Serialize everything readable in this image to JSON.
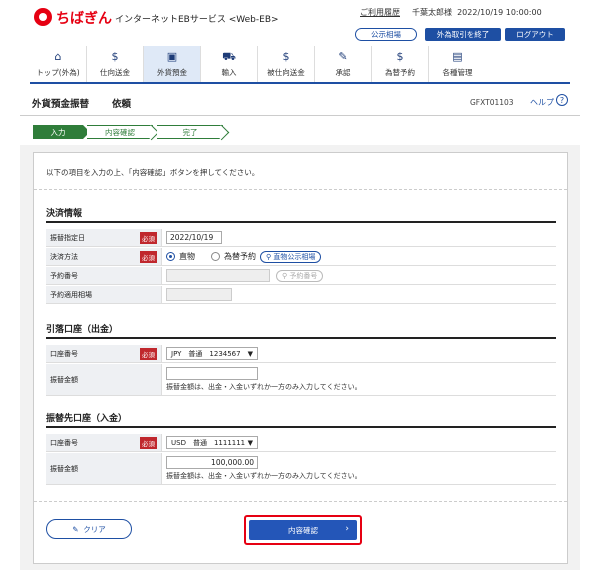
{
  "header": {
    "brand": "ちばぎん",
    "brand_sub": "インターネットEBサービス <Web-EB>",
    "link_help": "ご利用履歴",
    "user": "千葉太郎様",
    "datetime": "2022/10/19 10:00:00",
    "btn_rates": "公示相場",
    "btn_end_fx": "外為取引を終了",
    "btn_logout": "ログアウト"
  },
  "nav": [
    {
      "label": "トップ(外為)",
      "icon": "home-icon",
      "glyph": "⌂"
    },
    {
      "label": "仕向送金",
      "icon": "money-send-icon",
      "glyph": "$"
    },
    {
      "label": "外貨預金",
      "icon": "deposit-icon",
      "glyph": "▣"
    },
    {
      "label": "輸入",
      "icon": "import-icon",
      "glyph": "⛟"
    },
    {
      "label": "被仕向送金",
      "icon": "money-receive-icon",
      "glyph": "$"
    },
    {
      "label": "承認",
      "icon": "approve-icon",
      "glyph": "✎"
    },
    {
      "label": "為替予約",
      "icon": "fx-contract-icon",
      "glyph": "$"
    },
    {
      "label": "各種管理",
      "icon": "admin-icon",
      "glyph": "▤"
    }
  ],
  "page": {
    "title": "外貨預金振替",
    "subtitle": "依頼",
    "code": "GFXT01103",
    "help": "ヘルプ",
    "help_glyph": "?"
  },
  "steps": [
    "入力",
    "内容確認",
    "完了"
  ],
  "instruction": "以下の項目を入力の上、「内容確認」ボタンを押してください。",
  "required_label": "必須",
  "settlement": {
    "heading": "決済情報",
    "date_label": "振替指定日",
    "date_value": "2022/10/19",
    "method_label": "決済方法",
    "method_opt1": "直物",
    "method_opt2": "為替予約",
    "rate_btn": "直物公示相場",
    "contract_label": "予約番号",
    "contract_btn": "予約番号",
    "contract_rate_label": "予約適用相場"
  },
  "debit": {
    "heading": "引落口座（出金）",
    "account_label": "口座番号",
    "account_value": "JPY　普通　1234567",
    "amount_label": "振替金額",
    "amount_value": "",
    "note": "振替金額は、出金・入金いずれか一方のみ入力してください。"
  },
  "credit": {
    "heading": "振替先口座（入金）",
    "account_label": "口座番号",
    "account_value": "USD　普通　1111111",
    "amount_label": "振替金額",
    "amount_value": "100,000.00",
    "note": "振替金額は、出金・入金いずれか一方のみ入力してください。"
  },
  "actions": {
    "clear": "クリア",
    "confirm": "内容確認"
  }
}
